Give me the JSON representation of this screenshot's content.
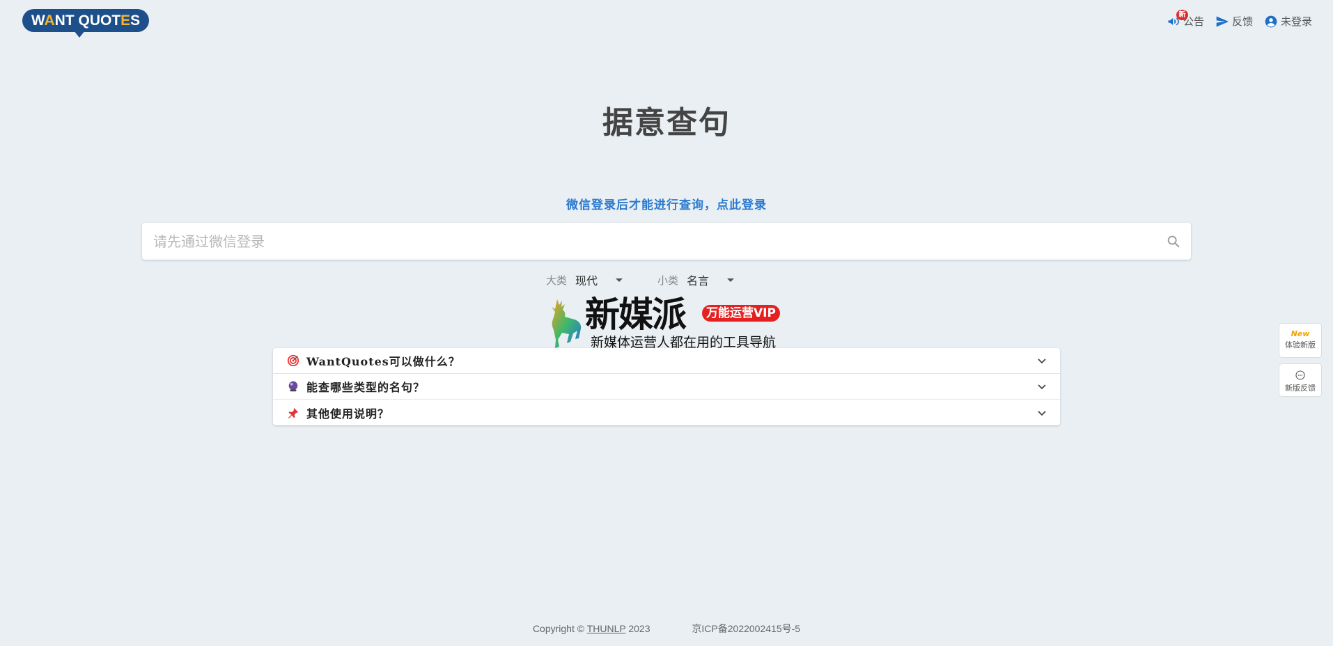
{
  "header": {
    "logo_text_a": "W",
    "logo_text_b": "NT QUOT",
    "logo_text_c": "S",
    "nav": [
      {
        "label": "公告",
        "badge": "新",
        "icon": "megaphone-icon"
      },
      {
        "label": "反馈",
        "icon": "send-icon"
      },
      {
        "label": "未登录",
        "icon": "account-icon"
      }
    ]
  },
  "main": {
    "title": "据意查句",
    "login_hint": "微信登录后才能进行查询，点此登录",
    "search_placeholder": "请先通过微信登录",
    "filters": [
      {
        "label": "大类",
        "value": "现代"
      },
      {
        "label": "小类",
        "value": "名言"
      }
    ]
  },
  "ad": {
    "title": "新媒派",
    "badge": "万能运营VIP",
    "subtitle": "新媒体运营人都在用的工具导航"
  },
  "faq": [
    {
      "text": "WantQuotes可以做什么？",
      "icon": "target-icon"
    },
    {
      "text": "能查哪些类型的名句？",
      "icon": "crystal-ball-icon"
    },
    {
      "text": "其他使用说明？",
      "icon": "pushpin-icon"
    }
  ],
  "side_buttons": {
    "try_new_tag": "New",
    "try_new_label": "体验新版",
    "feedback_label": "新版反馈"
  },
  "footer": {
    "copyright_prefix": "Copyright ©",
    "org": "THUNLP",
    "year": "2023",
    "icp": "京ICP备2022002415号-5"
  },
  "colors": {
    "background": "#e9eff2",
    "accent_blue": "#2a7ad0",
    "logo_blue": "#1d4f8a"
  }
}
